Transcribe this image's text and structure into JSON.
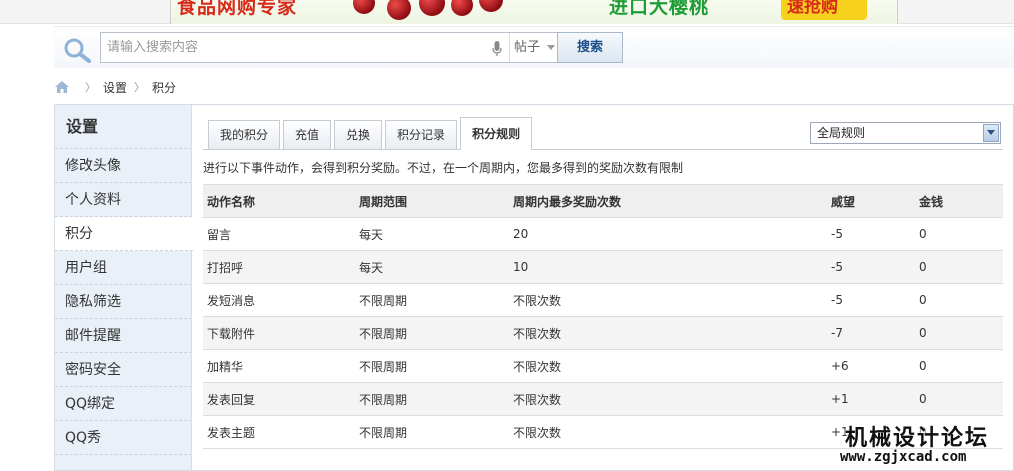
{
  "banner": {
    "ad_left_text": "食品网购专家",
    "ad_mid_text": "进口大樱桃",
    "ad_right_text": "速抢购"
  },
  "search": {
    "placeholder": "请输入搜索内容",
    "value": "",
    "type_label": "帖子",
    "button_label": "搜索"
  },
  "breadcrumb": {
    "items": [
      "设置",
      "积分"
    ]
  },
  "sidebar": {
    "title": "设置",
    "items": [
      {
        "label": "修改头像",
        "active": false
      },
      {
        "label": "个人资料",
        "active": false
      },
      {
        "label": "积分",
        "active": true
      },
      {
        "label": "用户组",
        "active": false
      },
      {
        "label": "隐私筛选",
        "active": false
      },
      {
        "label": "邮件提醒",
        "active": false
      },
      {
        "label": "密码安全",
        "active": false
      },
      {
        "label": "QQ绑定",
        "active": false
      },
      {
        "label": "QQ秀",
        "active": false
      }
    ]
  },
  "tabs": [
    {
      "label": "我的积分",
      "active": false
    },
    {
      "label": "充值",
      "active": false
    },
    {
      "label": "兑换",
      "active": false
    },
    {
      "label": "积分记录",
      "active": false
    },
    {
      "label": "积分规则",
      "active": true
    }
  ],
  "scope_select": {
    "selected": "全局规则"
  },
  "intro": "进行以下事件动作，会得到积分奖励。不过，在一个周期内，您最多得到的奖励次数有限制",
  "table": {
    "columns": [
      "动作名称",
      "周期范围",
      "周期内最多奖励次数",
      "威望",
      "金钱"
    ],
    "rows": [
      [
        "留言",
        "每天",
        "20",
        "-5",
        "0"
      ],
      [
        "打招呼",
        "每天",
        "10",
        "-5",
        "0"
      ],
      [
        "发短消息",
        "不限周期",
        "不限次数",
        "-5",
        "0"
      ],
      [
        "下载附件",
        "不限周期",
        "不限次数",
        "-7",
        "0"
      ],
      [
        "加精华",
        "不限周期",
        "不限次数",
        "+6",
        "0"
      ],
      [
        "发表回复",
        "不限周期",
        "不限次数",
        "+1",
        "0"
      ],
      [
        "发表主题",
        "不限周期",
        "不限次数",
        "+1",
        "0"
      ]
    ]
  },
  "watermark": {
    "title": "机械设计论坛",
    "url": "www.zgjxcad.com"
  },
  "colors": {
    "sidebar_bg": "#e9f0f8",
    "search_button_text": "#1e4f8a",
    "header_row_bg": "#efefef",
    "alt_row_bg": "#f4f4f4"
  }
}
